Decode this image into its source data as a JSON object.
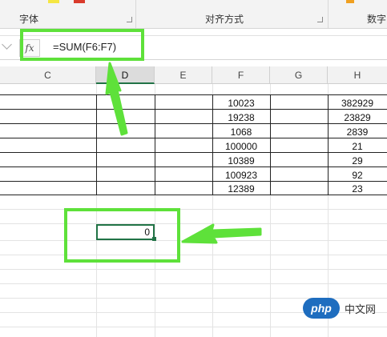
{
  "ribbon": {
    "groups": [
      "字体",
      "对齐方式",
      "数字"
    ]
  },
  "formula_bar": {
    "fx_label": "fx",
    "formula": "=SUM(F6:F7)"
  },
  "columns": [
    "C",
    "D",
    "E",
    "F",
    "G",
    "H"
  ],
  "active_column": "D",
  "rows": [
    {
      "F": "10023",
      "H": "382929"
    },
    {
      "F": "19238",
      "H": "23829"
    },
    {
      "F": "1068",
      "H": "2839"
    },
    {
      "F": "100000",
      "H": "21"
    },
    {
      "F": "10389",
      "H": "29"
    },
    {
      "F": "100923",
      "H": "92"
    },
    {
      "F": "12389",
      "H": "23"
    }
  ],
  "selected_cell": {
    "value": "0"
  },
  "annotation_color": "#5ee13a",
  "watermark": {
    "logo": "php",
    "text": "中文网"
  }
}
